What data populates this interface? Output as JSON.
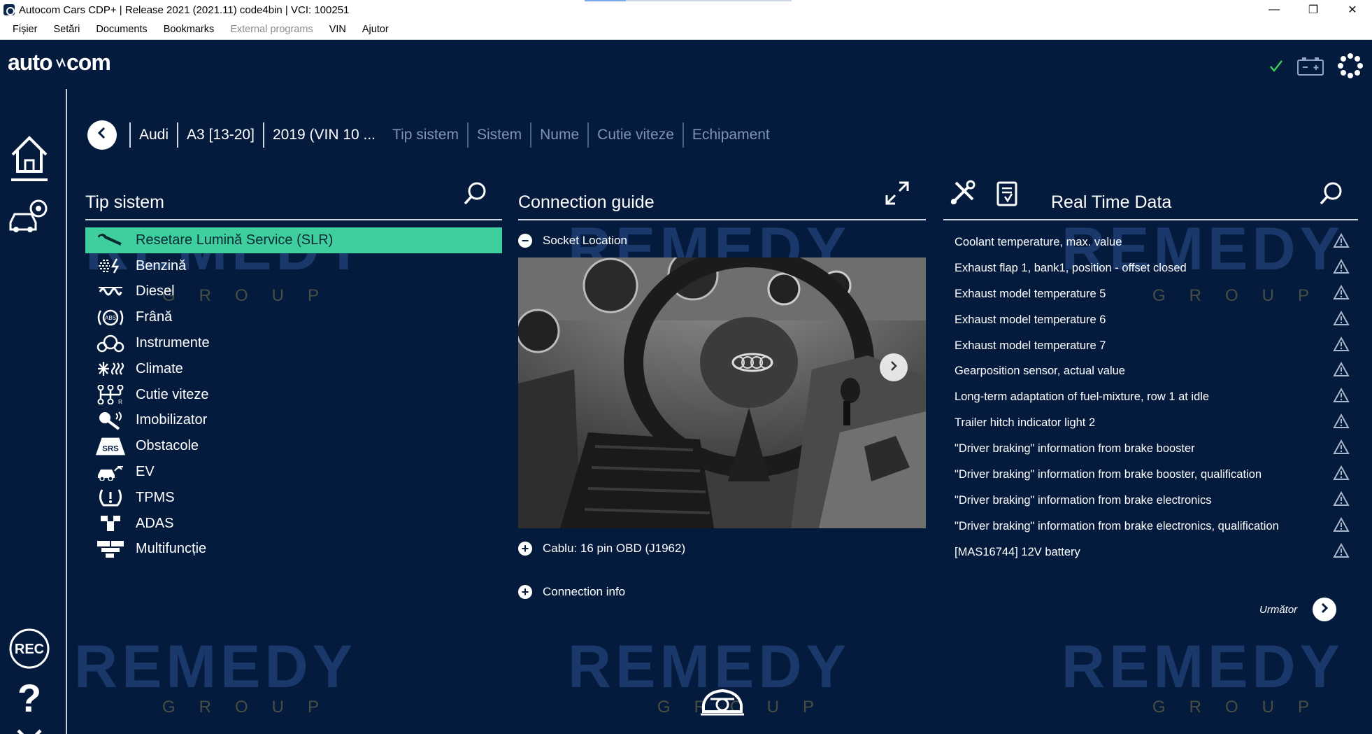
{
  "window": {
    "title": "Autocom Cars CDP+ |  Release 2021 (2021.11) code4bin  |  VCI: 100251",
    "minimize": "—",
    "restore": "❐",
    "close": "✕",
    "loading_progress": 0.2
  },
  "menu": {
    "items": [
      {
        "label": "Fișier",
        "enabled": true
      },
      {
        "label": "Setări",
        "enabled": true
      },
      {
        "label": "Documents",
        "enabled": true
      },
      {
        "label": "Bookmarks",
        "enabled": true
      },
      {
        "label": "External programs",
        "enabled": false
      },
      {
        "label": "VIN",
        "enabled": true
      },
      {
        "label": "Ajutor",
        "enabled": true
      }
    ]
  },
  "brand": {
    "logo_text": "auto com",
    "accent": "#3fcf9f",
    "background": "#041b3e"
  },
  "breadcrumb": {
    "items": [
      {
        "label": "Audi",
        "active": true
      },
      {
        "label": "A3 [13-20]",
        "active": true
      },
      {
        "label": "2019 (VIN 10 ...",
        "active": true
      },
      {
        "label": "Tip sistem",
        "active": false
      },
      {
        "label": "Sistem",
        "active": false
      },
      {
        "label": "Nume",
        "active": false
      },
      {
        "label": "Cutie viteze",
        "active": false
      },
      {
        "label": "Echipament",
        "active": false
      }
    ]
  },
  "system_panel": {
    "title": "Tip sistem",
    "items": [
      {
        "label": "Resetare Lumină Service (SLR)",
        "icon": "wrench-icon",
        "selected": true
      },
      {
        "label": "Benzină",
        "icon": "petrol-injection-icon",
        "selected": false
      },
      {
        "label": "Diesel",
        "icon": "glow-plug-icon",
        "selected": false
      },
      {
        "label": "Frână",
        "icon": "abs-icon",
        "selected": false
      },
      {
        "label": "Instrumente",
        "icon": "gauges-icon",
        "selected": false
      },
      {
        "label": "Climate",
        "icon": "climate-icon",
        "selected": false
      },
      {
        "label": "Cutie viteze",
        "icon": "gearbox-icon",
        "selected": false
      },
      {
        "label": "Imobilizator",
        "icon": "key-icon",
        "selected": false
      },
      {
        "label": "Obstacole",
        "icon": "srs-icon",
        "selected": false
      },
      {
        "label": "EV",
        "icon": "ev-car-icon",
        "selected": false
      },
      {
        "label": "TPMS",
        "icon": "tpms-icon",
        "selected": false
      },
      {
        "label": "ADAS",
        "icon": "adas-icon",
        "selected": false
      },
      {
        "label": "Multifuncție",
        "icon": "multifunction-icon",
        "selected": false
      }
    ]
  },
  "guide_panel": {
    "title": "Connection guide",
    "socket_location": "Socket Location",
    "cable": "Cablu: 16 pin OBD (J1962)",
    "connection_info": "Connection info"
  },
  "realtime_panel": {
    "title": "Real Time Data",
    "items": [
      "Coolant temperature, max. value",
      "Exhaust flap 1, bank1, position - offset closed",
      "Exhaust model temperature 5",
      "Exhaust model temperature 6",
      "Exhaust model temperature 7",
      "Gearposition sensor, actual value",
      "Long-term adaptation of fuel-mixture, row 1 at idle",
      "Trailer hitch indicator light 2",
      "\"Driver braking\" information from brake booster",
      "\"Driver braking\" information from brake booster, qualification",
      "\"Driver braking\" information from brake electronics",
      "\"Driver braking\" information from brake electronics, qualification",
      "[MAS16744] 12V battery"
    ],
    "next_label": "Următor"
  },
  "rail": {
    "rec_label": "REC",
    "help_label": "?"
  },
  "watermark": {
    "main": "REMEDY",
    "sub": "GROUP"
  }
}
